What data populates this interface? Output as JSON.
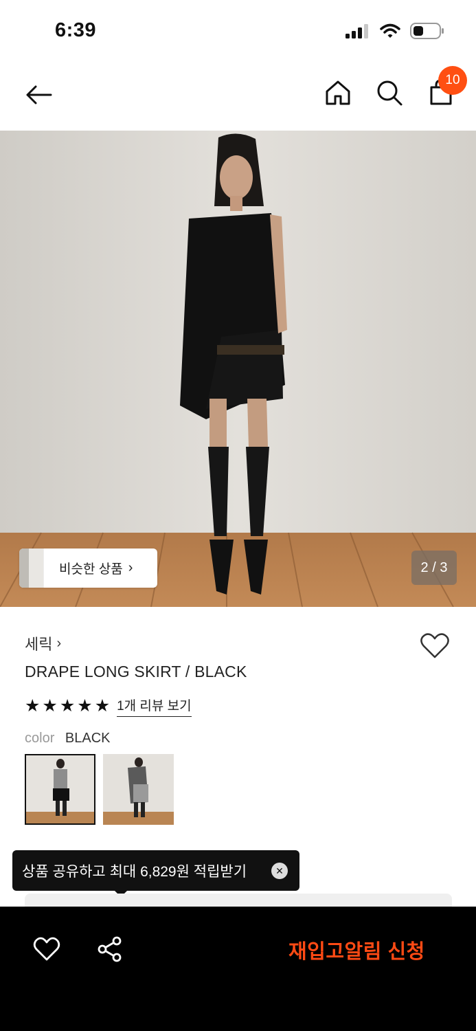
{
  "status": {
    "time": "6:39"
  },
  "nav": {
    "cart_count": "10"
  },
  "hero": {
    "similar_label": "비슷한 상품",
    "page_indicator": "2 / 3"
  },
  "product": {
    "brand": "세릭",
    "title": "DRAPE LONG SKIRT / BLACK",
    "rating_stars": 5,
    "review_link": "1개 리뷰 보기",
    "color_key": "color",
    "color_value": "BLACK"
  },
  "tooltip": {
    "text": "상품 공유하고 최대 6,829원 적립받기"
  },
  "bottom_bar": {
    "cta_label": "재입고알림 신청"
  },
  "colors": {
    "accent": "#ff4f12",
    "cta": "#ff4a14",
    "bottom_bar": "#000000"
  }
}
